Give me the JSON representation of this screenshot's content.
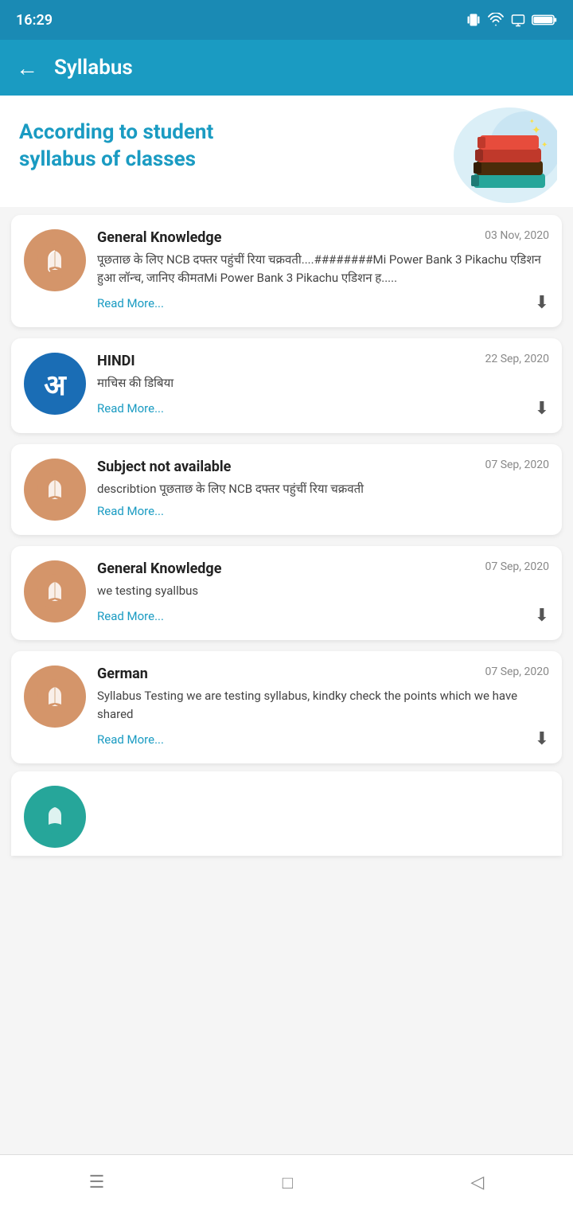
{
  "statusBar": {
    "time": "16:29"
  },
  "header": {
    "back_label": "←",
    "title": "Syllabus"
  },
  "hero": {
    "line1": "According to student",
    "line2": "syllabus of classes"
  },
  "cards": [
    {
      "id": 1,
      "subject": "General Knowledge",
      "date": "03 Nov, 2020",
      "description": "पूछताछ के लिए NCB दफ्तर पहुंचीं रिया चक्रवती....########Mi Power Bank 3 Pikachu एडिशन हुआ लॉन्च, जानिए कीमतMi Power Bank 3 Pikachu एडिशन ह.....",
      "read_more": "Read More...",
      "icon_type": "book",
      "has_download": true
    },
    {
      "id": 2,
      "subject": "HINDI",
      "date": "22 Sep, 2020",
      "description": "माचिस की डिबिया",
      "read_more": "Read More...",
      "icon_type": "hindi",
      "has_download": true
    },
    {
      "id": 3,
      "subject": "Subject not available",
      "date": "07 Sep, 2020",
      "description": "describtion पूछताछ के लिए NCB दफ्तर पहुंचीं रिया चक्रवती",
      "read_more": "Read More...",
      "icon_type": "book",
      "has_download": false
    },
    {
      "id": 4,
      "subject": "General Knowledge",
      "date": "07 Sep, 2020",
      "description": "we testing syallbus",
      "read_more": "Read More...",
      "icon_type": "book",
      "has_download": true
    },
    {
      "id": 5,
      "subject": "German",
      "date": "07 Sep, 2020",
      "description": "Syllabus Testing we are testing syllabus, kindky check the points which we have shared",
      "read_more": "Read More...",
      "icon_type": "book",
      "has_download": true
    }
  ],
  "bottomNav": {
    "menu_icon": "☰",
    "home_icon": "□",
    "back_icon": "◁"
  }
}
